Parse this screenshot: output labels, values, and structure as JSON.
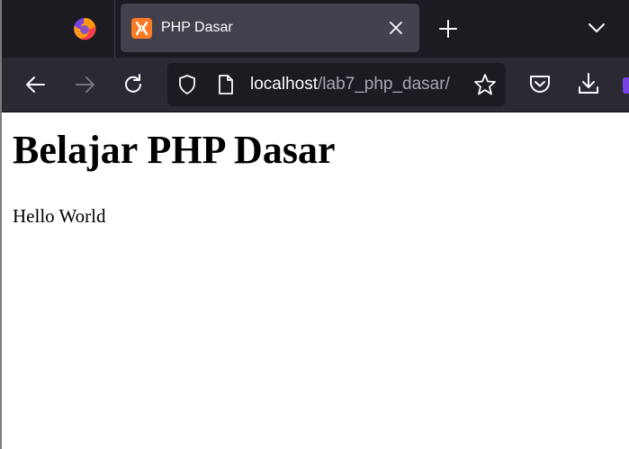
{
  "browser": {
    "tab": {
      "title": "PHP Dasar",
      "favicon": "xampp-icon",
      "close_icon": "close-icon"
    },
    "new_tab_icon": "plus-icon",
    "tab_list_icon": "chevron-down-icon",
    "nav": {
      "back_icon": "arrow-left-icon",
      "forward_icon": "arrow-right-icon",
      "reload_icon": "reload-icon"
    },
    "urlbar": {
      "host": "localhost",
      "path": "/lab7_php_dasar/",
      "shield_icon": "shield-icon",
      "page_icon": "page-icon",
      "star_icon": "star-icon"
    },
    "toolbar_icons": [
      "pocket-icon",
      "download-icon"
    ],
    "colors": {
      "tabstrip": "#1c1b22",
      "toolbar": "#2b2a33",
      "active_tab": "#42414d",
      "favicon": "#fb7a24"
    }
  },
  "page": {
    "heading": "Belajar PHP Dasar",
    "text": "Hello World"
  }
}
